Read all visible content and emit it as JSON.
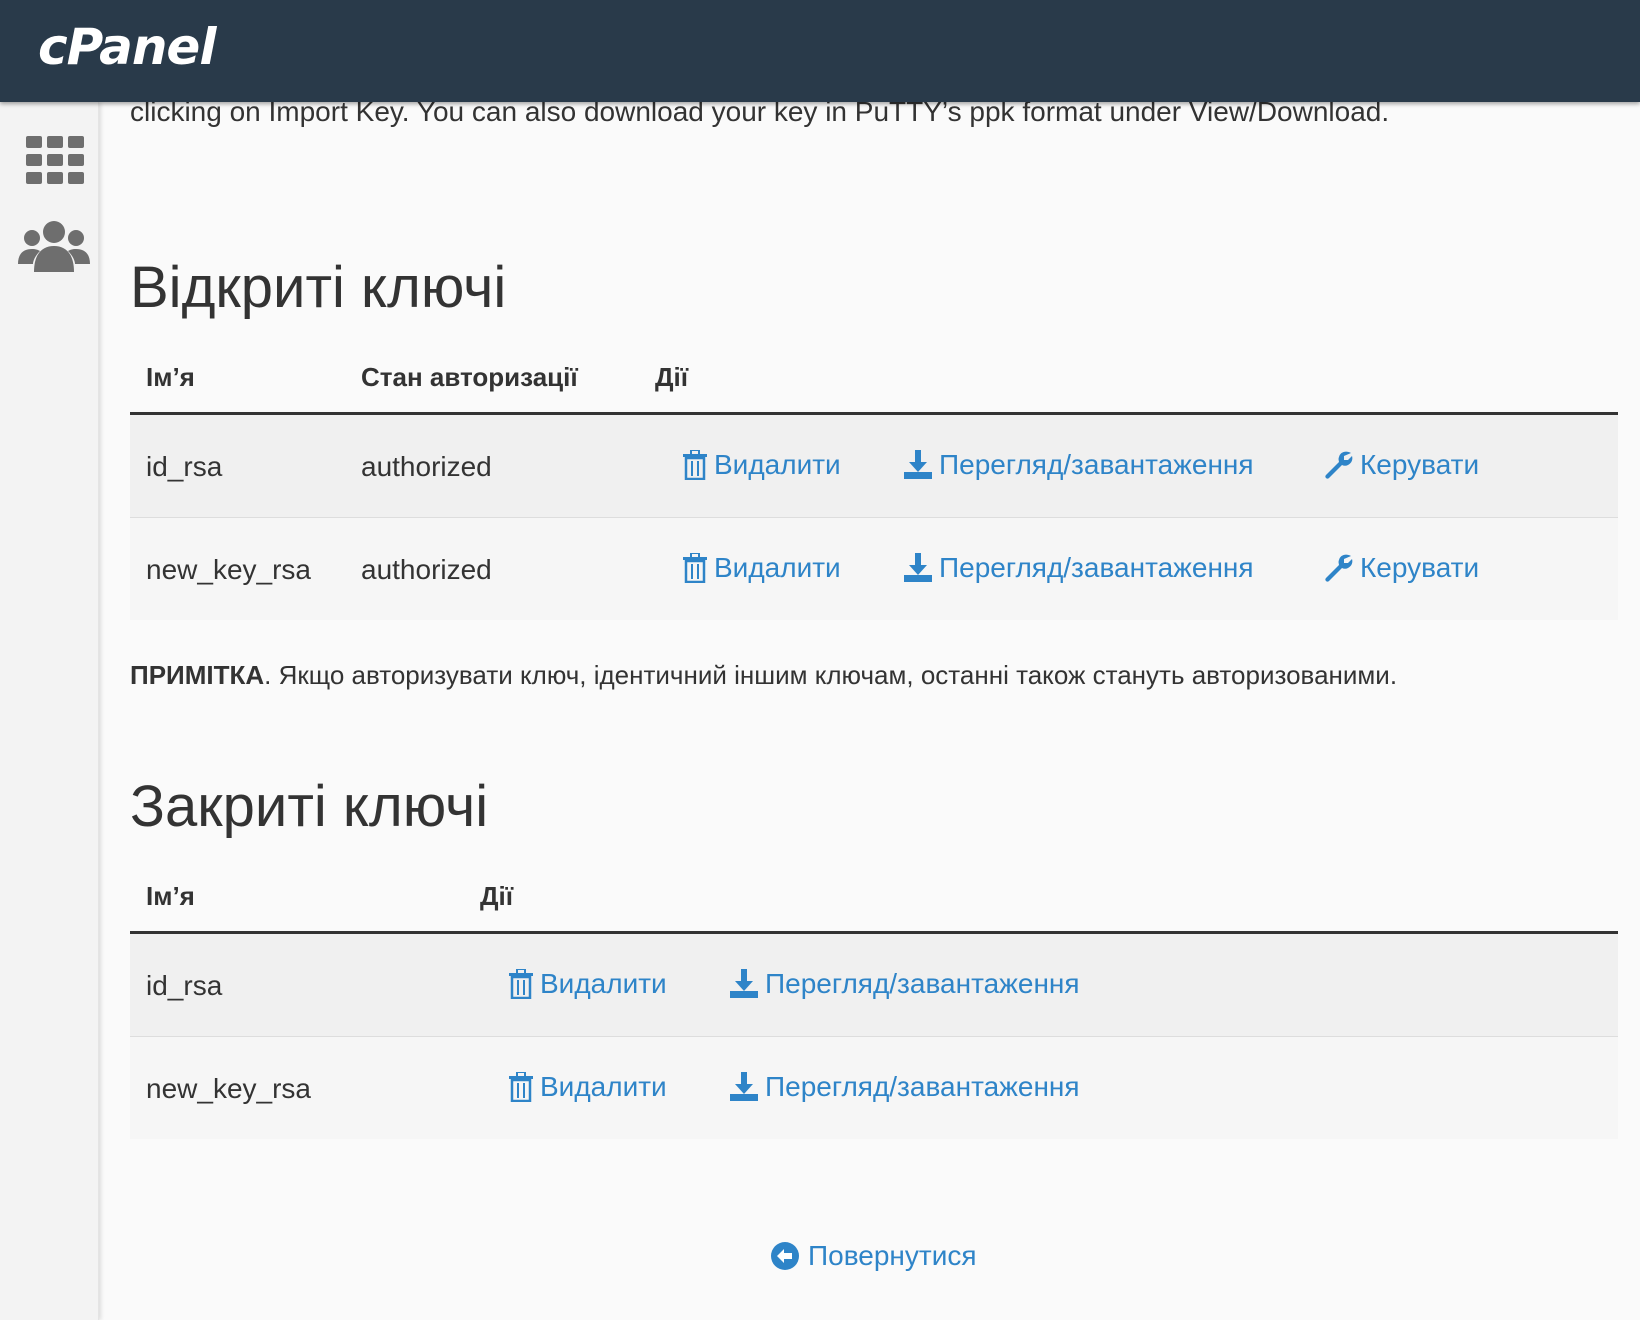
{
  "header": {
    "logo": "cPanel"
  },
  "sidebar": {
    "items": [
      {
        "icon": "grid-icon"
      },
      {
        "icon": "users-icon"
      }
    ]
  },
  "intro_text": "clicking on Import Key. You can also download your key in PuTTY’s ppk format under View/Download.",
  "public_keys": {
    "heading": "Відкриті ключі",
    "columns": {
      "name": "Ім’я",
      "auth": "Стан авторизації",
      "actions": "Дії"
    },
    "rows": [
      {
        "name": "id_rsa",
        "status": "authorized",
        "delete": "Видалити",
        "view": "Перегляд/завантаження",
        "manage": "Керувати"
      },
      {
        "name": "new_key_rsa",
        "status": "authorized",
        "delete": "Видалити",
        "view": "Перегляд/завантаження",
        "manage": "Керувати"
      }
    ]
  },
  "note": {
    "label": "ПРИМІТКА",
    "text": ". Якщо авторизувати ключ, ідентичний іншим ключам, останні також стануть авторизованими."
  },
  "private_keys": {
    "heading": "Закриті ключі",
    "columns": {
      "name": "Ім’я",
      "actions": "Дії"
    },
    "rows": [
      {
        "name": "id_rsa",
        "delete": "Видалити",
        "view": "Перегляд/завантаження"
      },
      {
        "name": "new_key_rsa",
        "delete": "Видалити",
        "view": "Перегляд/завантаження"
      }
    ]
  },
  "back_link": "Повернутися",
  "colors": {
    "header_bg": "#293a4a",
    "link": "#2e84c8",
    "text": "#333333"
  }
}
